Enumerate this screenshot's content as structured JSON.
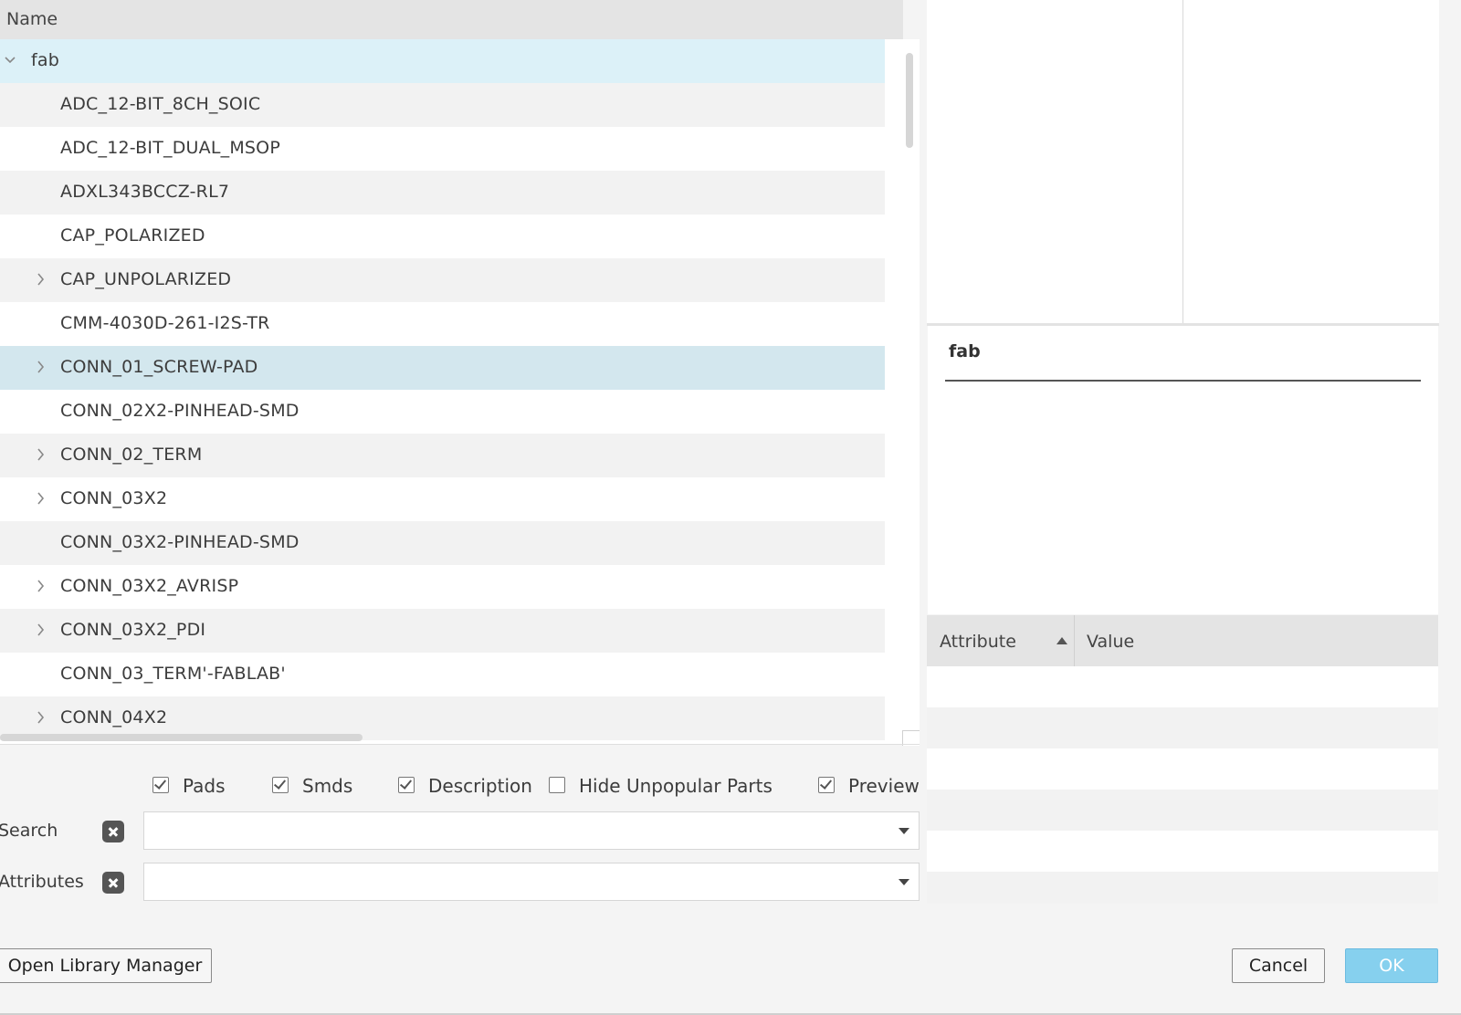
{
  "tree": {
    "header": "Name",
    "root": "fab",
    "items": [
      {
        "label": "ADC_12-BIT_8CH_SOIC",
        "expandable": false
      },
      {
        "label": "ADC_12-BIT_DUAL_MSOP",
        "expandable": false
      },
      {
        "label": "ADXL343BCCZ-RL7",
        "expandable": false
      },
      {
        "label": "CAP_POLARIZED",
        "expandable": false
      },
      {
        "label": "CAP_UNPOLARIZED",
        "expandable": true
      },
      {
        "label": "CMM-4030D-261-I2S-TR",
        "expandable": false
      },
      {
        "label": "CONN_01_SCREW-PAD",
        "expandable": true,
        "selected": true
      },
      {
        "label": "CONN_02X2-PINHEAD-SMD",
        "expandable": false
      },
      {
        "label": "CONN_02_TERM",
        "expandable": true
      },
      {
        "label": "CONN_03X2",
        "expandable": true
      },
      {
        "label": "CONN_03X2-PINHEAD-SMD",
        "expandable": false
      },
      {
        "label": "CONN_03X2_AVRISP",
        "expandable": true
      },
      {
        "label": "CONN_03X2_PDI",
        "expandable": true
      },
      {
        "label": "CONN_03_TERM'-FABLAB'",
        "expandable": false
      },
      {
        "label": "CONN_04X2",
        "expandable": true
      }
    ]
  },
  "filters": {
    "pads": {
      "label": "Pads",
      "checked": true
    },
    "smds": {
      "label": "Smds",
      "checked": true
    },
    "description": {
      "label": "Description",
      "checked": true
    },
    "hide_unpopular": {
      "label": "Hide Unpopular Parts",
      "checked": false
    },
    "preview": {
      "label": "Preview",
      "checked": true
    }
  },
  "search": {
    "label": "Search",
    "value": ""
  },
  "attributes_filter": {
    "label": "Attributes",
    "value": ""
  },
  "description_panel": {
    "title": "fab"
  },
  "attr_table": {
    "col_attribute": "Attribute",
    "col_value": "Value"
  },
  "buttons": {
    "open_library_manager": "Open Library Manager",
    "cancel": "Cancel",
    "ok": "OK"
  },
  "colors": {
    "root_row": "#dcf1f8",
    "selected_row": "#d3e7ee",
    "ok_button": "#86d0ee"
  }
}
